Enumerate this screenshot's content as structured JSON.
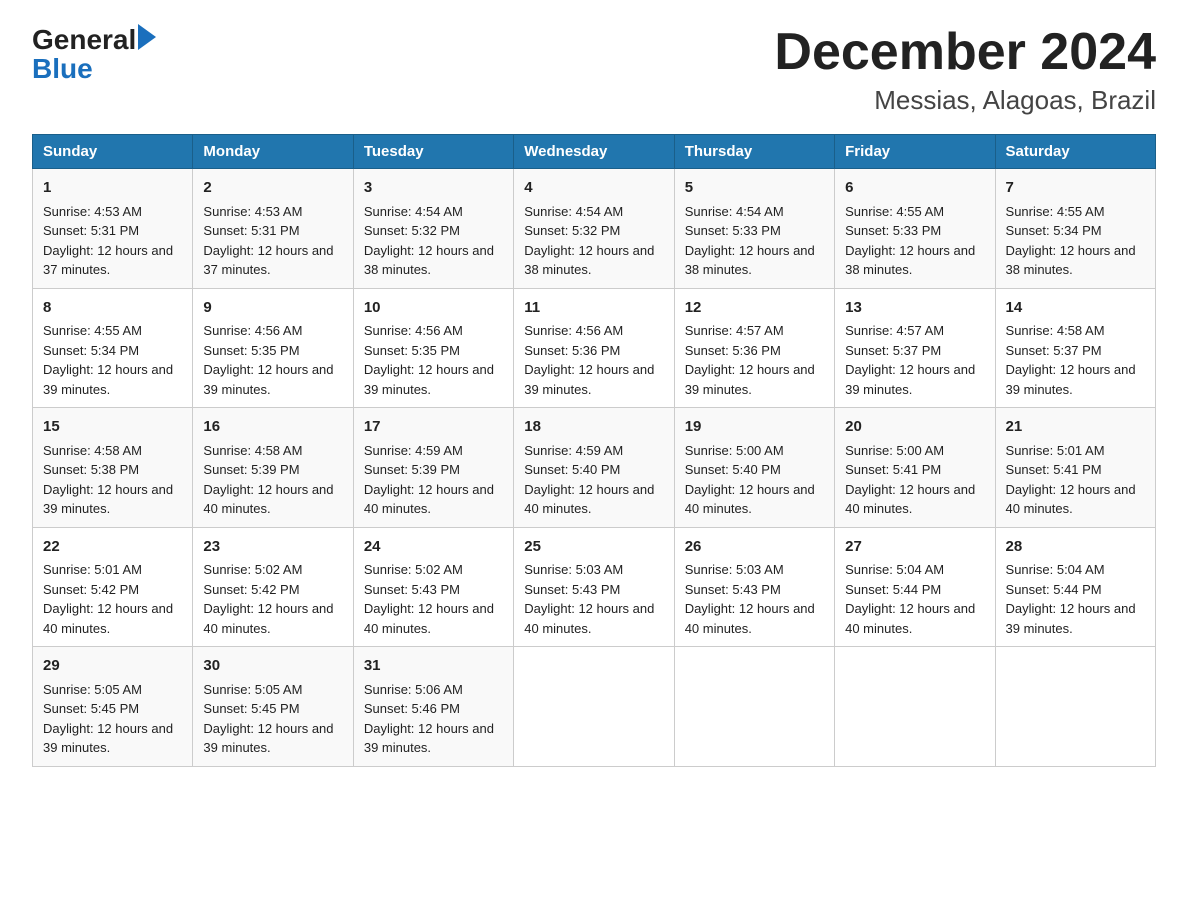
{
  "logo": {
    "general": "General",
    "blue": "Blue"
  },
  "header": {
    "month": "December 2024",
    "location": "Messias, Alagoas, Brazil"
  },
  "days_of_week": [
    "Sunday",
    "Monday",
    "Tuesday",
    "Wednesday",
    "Thursday",
    "Friday",
    "Saturday"
  ],
  "weeks": [
    [
      {
        "day": "1",
        "sunrise": "4:53 AM",
        "sunset": "5:31 PM",
        "daylight": "12 hours and 37 minutes."
      },
      {
        "day": "2",
        "sunrise": "4:53 AM",
        "sunset": "5:31 PM",
        "daylight": "12 hours and 37 minutes."
      },
      {
        "day": "3",
        "sunrise": "4:54 AM",
        "sunset": "5:32 PM",
        "daylight": "12 hours and 38 minutes."
      },
      {
        "day": "4",
        "sunrise": "4:54 AM",
        "sunset": "5:32 PM",
        "daylight": "12 hours and 38 minutes."
      },
      {
        "day": "5",
        "sunrise": "4:54 AM",
        "sunset": "5:33 PM",
        "daylight": "12 hours and 38 minutes."
      },
      {
        "day": "6",
        "sunrise": "4:55 AM",
        "sunset": "5:33 PM",
        "daylight": "12 hours and 38 minutes."
      },
      {
        "day": "7",
        "sunrise": "4:55 AM",
        "sunset": "5:34 PM",
        "daylight": "12 hours and 38 minutes."
      }
    ],
    [
      {
        "day": "8",
        "sunrise": "4:55 AM",
        "sunset": "5:34 PM",
        "daylight": "12 hours and 39 minutes."
      },
      {
        "day": "9",
        "sunrise": "4:56 AM",
        "sunset": "5:35 PM",
        "daylight": "12 hours and 39 minutes."
      },
      {
        "day": "10",
        "sunrise": "4:56 AM",
        "sunset": "5:35 PM",
        "daylight": "12 hours and 39 minutes."
      },
      {
        "day": "11",
        "sunrise": "4:56 AM",
        "sunset": "5:36 PM",
        "daylight": "12 hours and 39 minutes."
      },
      {
        "day": "12",
        "sunrise": "4:57 AM",
        "sunset": "5:36 PM",
        "daylight": "12 hours and 39 minutes."
      },
      {
        "day": "13",
        "sunrise": "4:57 AM",
        "sunset": "5:37 PM",
        "daylight": "12 hours and 39 minutes."
      },
      {
        "day": "14",
        "sunrise": "4:58 AM",
        "sunset": "5:37 PM",
        "daylight": "12 hours and 39 minutes."
      }
    ],
    [
      {
        "day": "15",
        "sunrise": "4:58 AM",
        "sunset": "5:38 PM",
        "daylight": "12 hours and 39 minutes."
      },
      {
        "day": "16",
        "sunrise": "4:58 AM",
        "sunset": "5:39 PM",
        "daylight": "12 hours and 40 minutes."
      },
      {
        "day": "17",
        "sunrise": "4:59 AM",
        "sunset": "5:39 PM",
        "daylight": "12 hours and 40 minutes."
      },
      {
        "day": "18",
        "sunrise": "4:59 AM",
        "sunset": "5:40 PM",
        "daylight": "12 hours and 40 minutes."
      },
      {
        "day": "19",
        "sunrise": "5:00 AM",
        "sunset": "5:40 PM",
        "daylight": "12 hours and 40 minutes."
      },
      {
        "day": "20",
        "sunrise": "5:00 AM",
        "sunset": "5:41 PM",
        "daylight": "12 hours and 40 minutes."
      },
      {
        "day": "21",
        "sunrise": "5:01 AM",
        "sunset": "5:41 PM",
        "daylight": "12 hours and 40 minutes."
      }
    ],
    [
      {
        "day": "22",
        "sunrise": "5:01 AM",
        "sunset": "5:42 PM",
        "daylight": "12 hours and 40 minutes."
      },
      {
        "day": "23",
        "sunrise": "5:02 AM",
        "sunset": "5:42 PM",
        "daylight": "12 hours and 40 minutes."
      },
      {
        "day": "24",
        "sunrise": "5:02 AM",
        "sunset": "5:43 PM",
        "daylight": "12 hours and 40 minutes."
      },
      {
        "day": "25",
        "sunrise": "5:03 AM",
        "sunset": "5:43 PM",
        "daylight": "12 hours and 40 minutes."
      },
      {
        "day": "26",
        "sunrise": "5:03 AM",
        "sunset": "5:43 PM",
        "daylight": "12 hours and 40 minutes."
      },
      {
        "day": "27",
        "sunrise": "5:04 AM",
        "sunset": "5:44 PM",
        "daylight": "12 hours and 40 minutes."
      },
      {
        "day": "28",
        "sunrise": "5:04 AM",
        "sunset": "5:44 PM",
        "daylight": "12 hours and 39 minutes."
      }
    ],
    [
      {
        "day": "29",
        "sunrise": "5:05 AM",
        "sunset": "5:45 PM",
        "daylight": "12 hours and 39 minutes."
      },
      {
        "day": "30",
        "sunrise": "5:05 AM",
        "sunset": "5:45 PM",
        "daylight": "12 hours and 39 minutes."
      },
      {
        "day": "31",
        "sunrise": "5:06 AM",
        "sunset": "5:46 PM",
        "daylight": "12 hours and 39 minutes."
      },
      null,
      null,
      null,
      null
    ]
  ]
}
